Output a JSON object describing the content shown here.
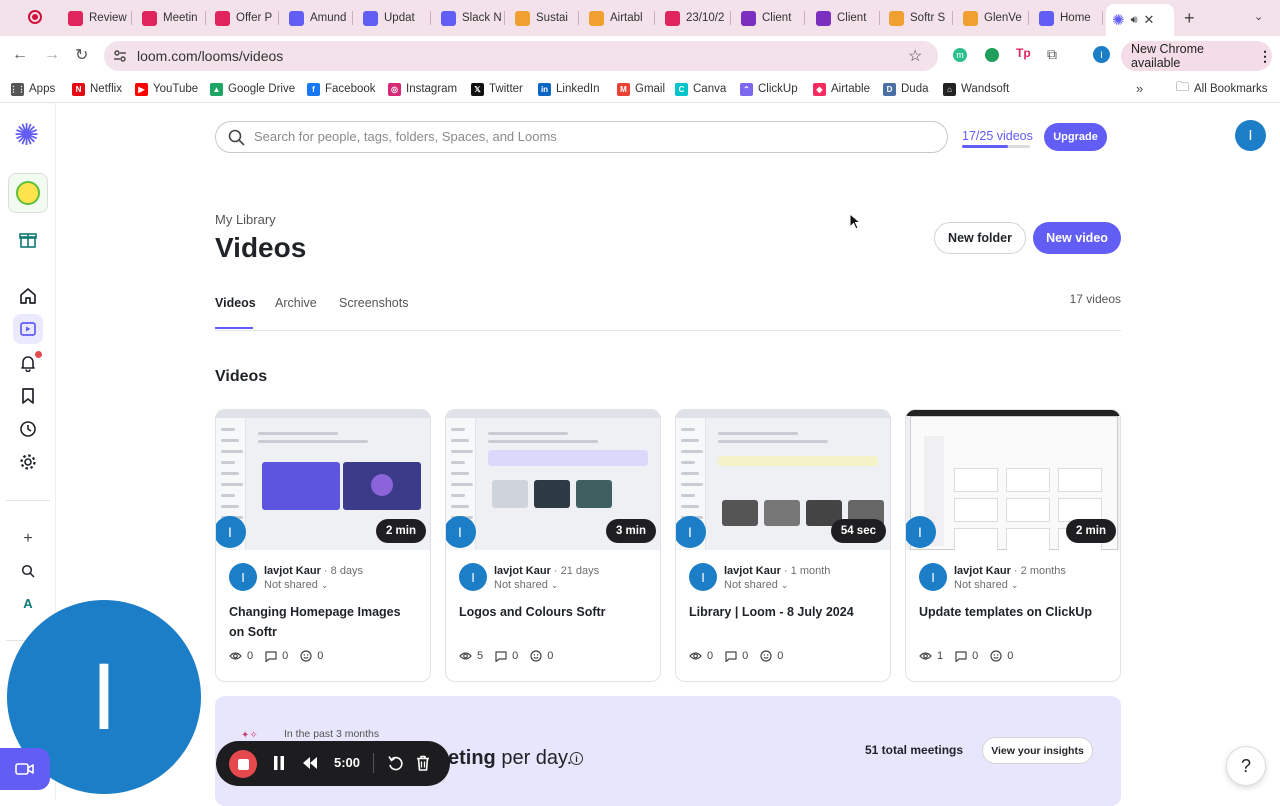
{
  "browser": {
    "tabs": [
      {
        "label": "Review",
        "color": "#e0245e"
      },
      {
        "label": "Meetin",
        "color": "#e0245e"
      },
      {
        "label": "Offer P",
        "color": "#e0245e"
      },
      {
        "label": "Amund",
        "color": "#625df5"
      },
      {
        "label": "Updat",
        "color": "#625df5"
      },
      {
        "label": "Slack N",
        "color": "#625df5"
      },
      {
        "label": "Sustai",
        "color": "#f0a030"
      },
      {
        "label": "Airtabl",
        "color": "#f0a030"
      },
      {
        "label": "23/10/2",
        "color": "#e0245e"
      },
      {
        "label": "Client",
        "color": "#7b2fbe"
      },
      {
        "label": "Client",
        "color": "#7b2fbe"
      },
      {
        "label": "Softr S",
        "color": "#f0a030"
      },
      {
        "label": "GlenVe",
        "color": "#f0a030"
      },
      {
        "label": "Home",
        "color": "#625df5"
      }
    ],
    "url": "loom.com/looms/videos",
    "new_chrome_label": "New Chrome available",
    "bookmarks": [
      {
        "label": "Apps"
      },
      {
        "label": "Netflix"
      },
      {
        "label": "YouTube"
      },
      {
        "label": "Google Drive"
      },
      {
        "label": "Facebook"
      },
      {
        "label": "Instagram"
      },
      {
        "label": "Twitter"
      },
      {
        "label": "LinkedIn"
      },
      {
        "label": "Gmail"
      },
      {
        "label": "Canva"
      },
      {
        "label": "ClickUp"
      },
      {
        "label": "Airtable"
      },
      {
        "label": "Duda"
      },
      {
        "label": "Wandsoft"
      }
    ],
    "all_bookmarks_label": "All Bookmarks",
    "profile_initial": "I"
  },
  "header": {
    "search_placeholder": "Search for people, tags, folders, Spaces, and Looms",
    "usage": "17/25 videos",
    "usage_fraction": 0.68,
    "upgrade_label": "Upgrade",
    "avatar_initial": "I"
  },
  "page": {
    "breadcrumb": "My Library",
    "title": "Videos",
    "new_folder_label": "New folder",
    "new_video_label": "New video",
    "tabs": [
      {
        "label": "Videos",
        "active": true
      },
      {
        "label": "Archive",
        "active": false
      },
      {
        "label": "Screenshots",
        "active": false
      }
    ],
    "video_count": "17 videos",
    "section_title": "Videos"
  },
  "videos": [
    {
      "owner": "lavjot Kaur",
      "age": "· 8 days",
      "shared": "Not shared",
      "title": "Changing Homepage Images on Softr",
      "duration": "2 min",
      "views": "0",
      "comments": "0",
      "reactions": "0"
    },
    {
      "owner": "lavjot Kaur",
      "age": "· 21 days",
      "shared": "Not shared",
      "title": "Logos and Colours Softr",
      "duration": "3 min",
      "views": "5",
      "comments": "0",
      "reactions": "0"
    },
    {
      "owner": "lavjot Kaur",
      "age": "· 1 month",
      "shared": "Not shared",
      "title": "Library | Loom - 8 July 2024",
      "duration": "54 sec",
      "views": "0",
      "comments": "0",
      "reactions": "0"
    },
    {
      "owner": "lavjot Kaur",
      "age": "· 2 months",
      "shared": "Not shared",
      "title": "Update templates on ClickUp",
      "duration": "2 min",
      "views": "1",
      "comments": "0",
      "reactions": "0"
    }
  ],
  "insights": {
    "period": "In the past 3 months",
    "headline_partial": "eting",
    "headline_rest": "per day.",
    "total_meetings": "51 total meetings",
    "button_label": "View your insights"
  },
  "recorder": {
    "timer": "5:00",
    "camera_initial": "I"
  },
  "help_label": "?",
  "sidebar_letter": "A"
}
